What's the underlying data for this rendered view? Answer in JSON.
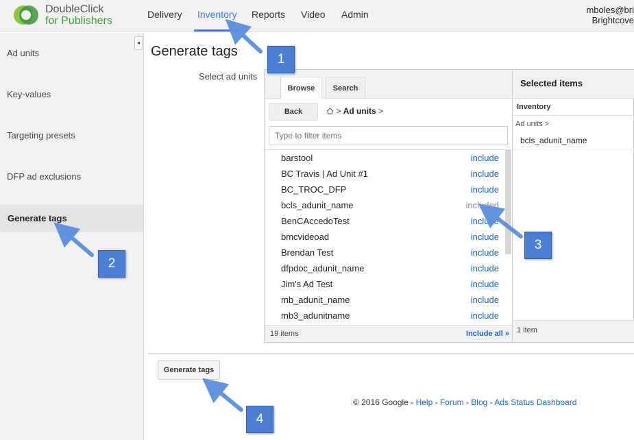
{
  "header": {
    "logo_line1": "DoubleClick",
    "logo_line2": "for Publishers",
    "nav": [
      "Delivery",
      "Inventory",
      "Reports",
      "Video",
      "Admin"
    ],
    "active_nav": "Inventory",
    "user_line1": "mboles@bri",
    "user_line2": "Brightcove"
  },
  "sidebar": {
    "items": [
      "Ad units",
      "Key-values",
      "Targeting presets",
      "DFP ad exclusions",
      "Generate tags"
    ],
    "active": "Generate tags",
    "collapse_glyph": "◂"
  },
  "main": {
    "title": "Generate tags",
    "select_label": "Select ad units"
  },
  "picker": {
    "tabs": [
      "Browse",
      "Search"
    ],
    "active_tab": "Browse",
    "back_label": "Back",
    "crumb_sep": ">",
    "crumb_current": "Ad units",
    "crumb_trailing": ">",
    "filter_placeholder": "Type to filter items",
    "rows": [
      {
        "name": "barstool",
        "action": "include"
      },
      {
        "name": "BC Travis | Ad Unit #1",
        "action": "include"
      },
      {
        "name": "BC_TROC_DFP",
        "action": "include"
      },
      {
        "name": "bcls_adunit_name",
        "action": "included"
      },
      {
        "name": "BenCAccedoTest",
        "action": "include"
      },
      {
        "name": "bmcvideoad",
        "action": "include"
      },
      {
        "name": "Brendan Test",
        "action": "include"
      },
      {
        "name": "dfpdoc_adunit_name",
        "action": "include"
      },
      {
        "name": "Jim's Ad Test",
        "action": "include"
      },
      {
        "name": "mb_adunit_name",
        "action": "include"
      },
      {
        "name": "mb3_adunitname",
        "action": "include"
      }
    ],
    "item_count": "19 items",
    "include_all": "Include all »"
  },
  "selected": {
    "title": "Selected items",
    "section": "Inventory",
    "crumb": "Ad units >",
    "items": [
      "bcls_adunit_name"
    ],
    "count": "1 item"
  },
  "actions": {
    "generate_label": "Generate tags"
  },
  "footer": {
    "copyright": "© 2016 Google - ",
    "links": [
      "Help",
      "Forum",
      "Blog",
      "Ads Status Dashboard"
    ],
    "sep": " - "
  },
  "callouts": [
    "1",
    "2",
    "3",
    "4"
  ],
  "colors": {
    "accent": "#3b78e7",
    "link": "#1a66c6",
    "callout": "#4b7fd6",
    "logo_green": "#3c9a3c"
  }
}
